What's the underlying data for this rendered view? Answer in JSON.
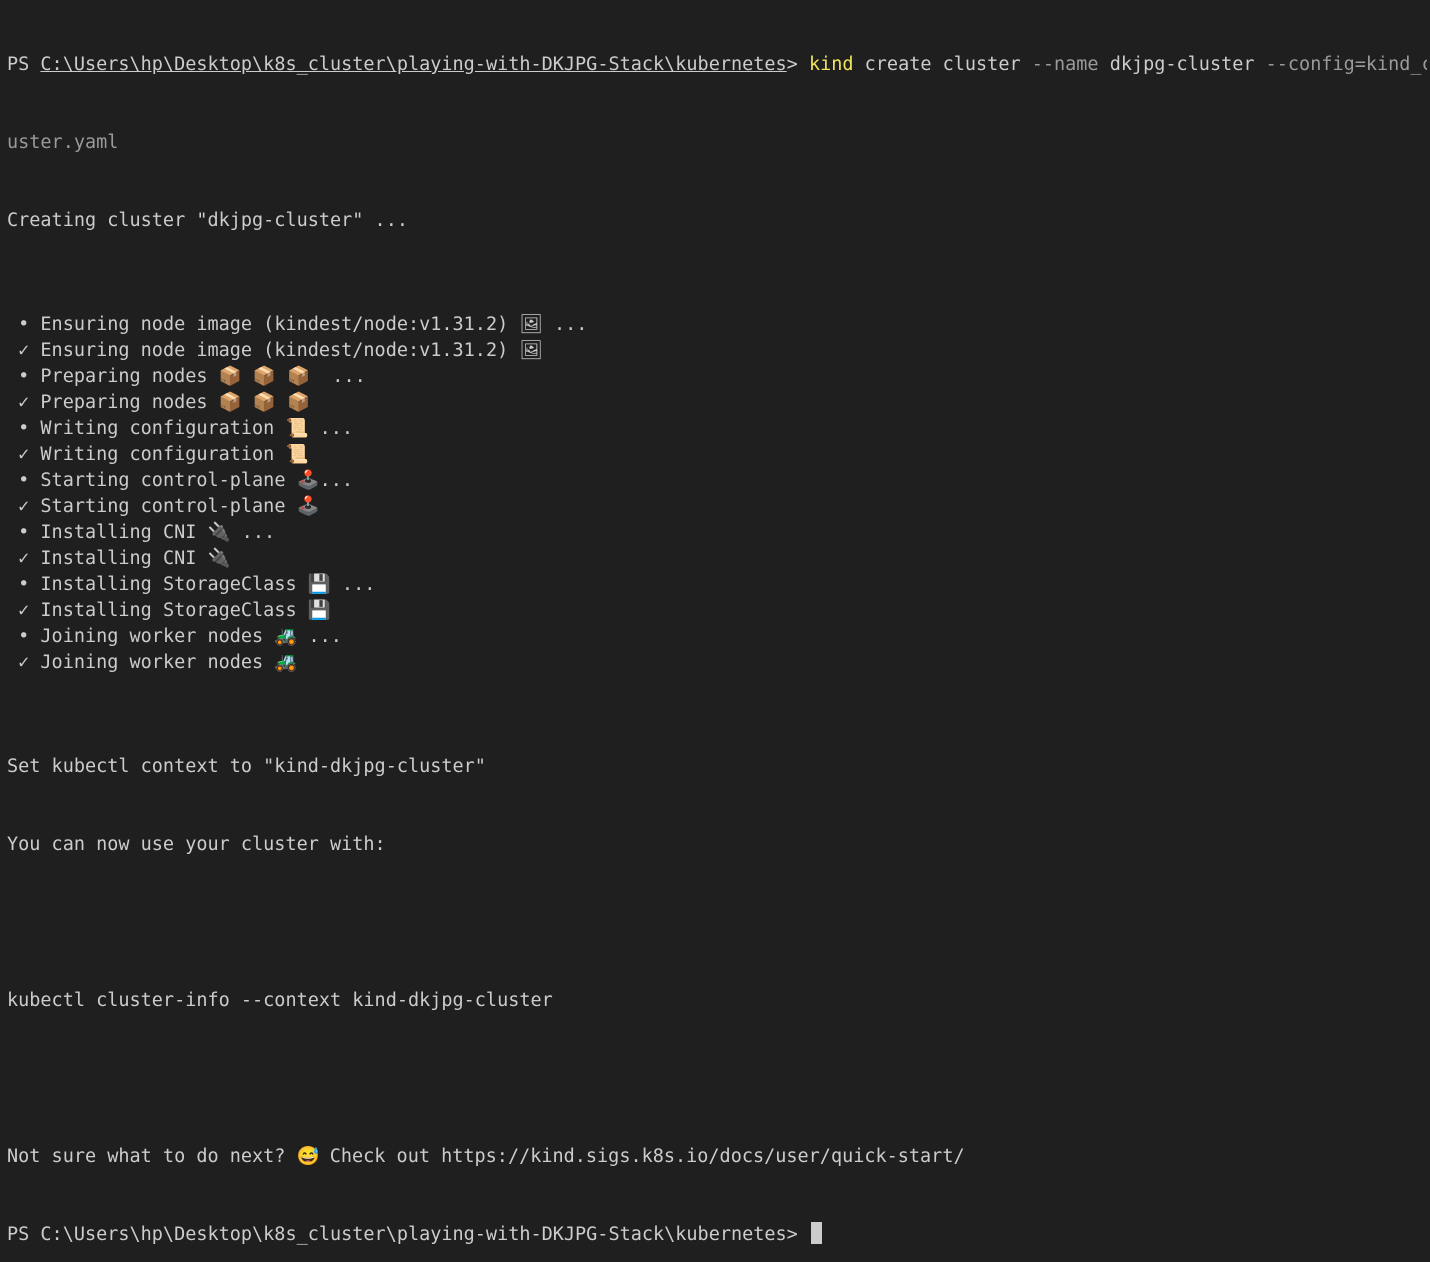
{
  "terminal": {
    "prompt_prefix": "PS ",
    "cwd": "C:\\Users\\hp\\Desktop\\k8s_cluster\\playing-with-DKJPG-Stack\\kubernetes",
    "prompt_suffix": ">",
    "command": {
      "program": "kind",
      "args": [
        "create",
        "cluster"
      ],
      "name_flag": "--name",
      "name_value": "dkjpg-cluster",
      "config_flag_part1": "--config=kind_cl",
      "config_flag_part2": "uster.yaml"
    },
    "creating_line": "Creating cluster \"dkjpg-cluster\" ...",
    "steps": [
      {
        "marker": "•",
        "text": "Ensuring node image (kindest/node:v1.31.2)",
        "emoji": "🖼",
        "tail": " ..."
      },
      {
        "marker": "✓",
        "text": "Ensuring node image (kindest/node:v1.31.2)",
        "emoji": "🖼",
        "tail": ""
      },
      {
        "marker": "•",
        "text": "Preparing nodes",
        "emoji": "📦 📦 📦",
        "tail": "  ..."
      },
      {
        "marker": "✓",
        "text": "Preparing nodes",
        "emoji": "📦 📦 📦",
        "tail": ""
      },
      {
        "marker": "•",
        "text": "Writing configuration",
        "emoji": "📜",
        "tail": " ..."
      },
      {
        "marker": "✓",
        "text": "Writing configuration",
        "emoji": "📜",
        "tail": ""
      },
      {
        "marker": "•",
        "text": "Starting control-plane",
        "emoji": "🕹️",
        "tail": "..."
      },
      {
        "marker": "✓",
        "text": "Starting control-plane",
        "emoji": "🕹️",
        "tail": ""
      },
      {
        "marker": "•",
        "text": "Installing CNI",
        "emoji": "🔌",
        "tail": " ..."
      },
      {
        "marker": "✓",
        "text": "Installing CNI",
        "emoji": "🔌",
        "tail": ""
      },
      {
        "marker": "•",
        "text": "Installing StorageClass",
        "emoji": "💾",
        "tail": " ..."
      },
      {
        "marker": "✓",
        "text": "Installing StorageClass",
        "emoji": "💾",
        "tail": ""
      },
      {
        "marker": "•",
        "text": "Joining worker nodes",
        "emoji": "🚜",
        "tail": " ..."
      },
      {
        "marker": "✓",
        "text": "Joining worker nodes",
        "emoji": "🚜",
        "tail": ""
      }
    ],
    "context_line": "Set kubectl context to \"kind-dkjpg-cluster\"",
    "usage_line": "You can now use your cluster with:",
    "kubectl_line": "kubectl cluster-info --context kind-dkjpg-cluster",
    "next_prefix": "Not sure what to do next?",
    "next_emoji": "😅",
    "next_suffix": " Check out https://kind.sigs.k8s.io/docs/user/quick-start/",
    "final_prompt": "PS C:\\Users\\hp\\Desktop\\k8s_cluster\\playing-with-DKJPG-Stack\\kubernetes>",
    "colors": {
      "background": "#1f1f1f",
      "text": "#cccccc",
      "command": "#f2e35c",
      "flag": "#9a9a9a"
    }
  }
}
